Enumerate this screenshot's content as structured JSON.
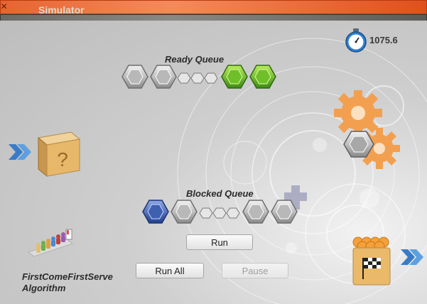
{
  "window": {
    "title": "Simulator"
  },
  "timer": {
    "value": "1075.6",
    "icon": "stopwatch-icon"
  },
  "ready_queue": {
    "label": "Ready Queue"
  },
  "blocked_queue": {
    "label": "Blocked Queue"
  },
  "buttons": {
    "run": "Run",
    "run_all": "Run All",
    "pause": "Pause"
  },
  "algorithm": {
    "line1": "FirstComeFirstServe",
    "line2": "Algorithm"
  },
  "colors": {
    "gear": "#f29a4a",
    "ready_hex": "#6fbf2a",
    "blocked_hex": "#3f5fb0",
    "arrow": "#3a7bc8"
  }
}
